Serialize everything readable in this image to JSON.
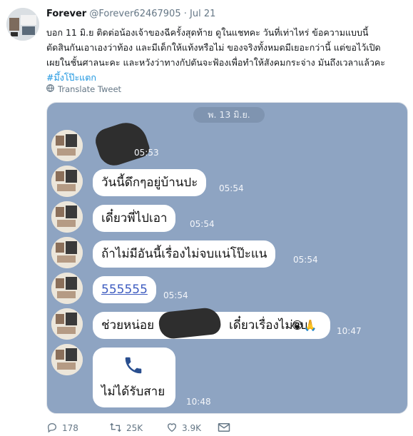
{
  "tweet": {
    "display_name": "Forever",
    "handle": "@Forever62467905",
    "separator": "·",
    "date": "Jul 21",
    "text_lines": [
      "บอก 11 มิ.ย ติดต่อน้องเจ้าของฉีครั้งสุดท้าย ดูในแชทคะ วันที่เท่าไหร่ ข้อความแบบนี้",
      "ตัดสินกันเอาเองว่าท้อง และมีเด็กให้แท้งหรือไม่  ของจริงทั้งหมดมีเยอะกว่านี้ แต่ขอไว้เปิด",
      "เผยในชั้นศาลนะคะ และหวังว่าทางกัปตันจะฟ้องเพื่อทำให้สังคมกระจ่าง มันถึงเวลาแล้วคะ"
    ],
    "hashtag": "#มึ้งโป๊ะแตก",
    "translate_label": "Translate Tweet"
  },
  "chat": {
    "date_header": "พ. 13 มิ.ย.",
    "messages": [
      {
        "text": "",
        "time": "05:53"
      },
      {
        "text": "วันนี้ดึกๆอยู่บ้านปะ",
        "time": "05:54"
      },
      {
        "text": "เดี๋ยวพี่ไปเอา",
        "time": "05:54"
      },
      {
        "text": "ถ้าไม่มีอันนี้เรื่องไม่จบแน่โป๊ะแน",
        "time": "05:54"
      },
      {
        "text": "555555",
        "time": "05:54"
      },
      {
        "text_before": "ช่วยหน่อย",
        "text_after": "เดี๋ยวเรื่องไม่จบ",
        "emoji": "😭🙏",
        "time": "10:47"
      },
      {
        "text": "ไม่ได้รับสาย",
        "time": "10:48"
      }
    ]
  },
  "actions": {
    "reply_count": "178",
    "retweet_count": "25K",
    "like_count": "3.9K"
  }
}
